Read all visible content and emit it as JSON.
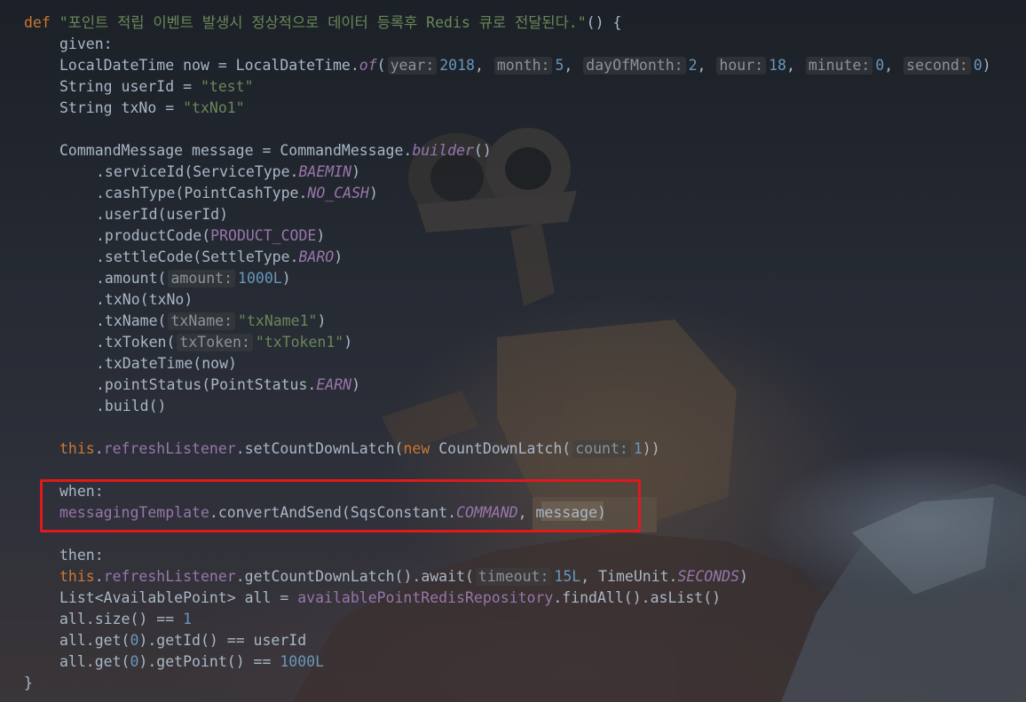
{
  "code": {
    "def_kw": "def",
    "test_name": "\"포인트 적립 이벤트 발생시 정상적으로 데이터 등록후 Redis 큐로 전달된다.\"",
    "def_open": "() {",
    "given_label": "given:",
    "now_decl": "LocalDateTime now = LocalDateTime.",
    "now_of": "of",
    "now_paren": "(",
    "hint_year": "year:",
    "val_year": "2018",
    "hint_month": "month:",
    "val_month": "5",
    "hint_day": "dayOfMonth:",
    "val_day": "2",
    "hint_hour": "hour:",
    "val_hour": "18",
    "hint_minute": "minute:",
    "val_minute": "0",
    "hint_second": "second:",
    "val_second": "0",
    "comma": ",",
    "close_paren": ")",
    "userid_decl": "String userId = ",
    "userid_val": "\"test\"",
    "txno_decl": "String txNo = ",
    "txno_val": "\"txNo1\"",
    "msg_decl": "CommandMessage message = CommandMessage.",
    "msg_builder": "builder",
    "msg_parens": "()",
    "service_pre": ".serviceId(ServiceType.",
    "service_const": "BAEMIN",
    "cash_pre": ".cashType(PointCashType.",
    "cash_const": "NO_CASH",
    "userid_line": ".userId(userId)",
    "product_pre": ".productCode(",
    "product_const": "PRODUCT_CODE",
    "settle_pre": ".settleCode(SettleType.",
    "settle_const": "BARO",
    "amount_pre": ".amount(",
    "hint_amount": "amount:",
    "val_amount": "1000L",
    "txno_line": ".txNo(txNo)",
    "txname_pre": ".txName(",
    "hint_txname": "txName:",
    "val_txname": "\"txName1\"",
    "txtoken_pre": ".txToken(",
    "hint_txtoken": "txToken:",
    "val_txtoken": "\"txToken1\"",
    "txdatetime_line": ".txDateTime(now)",
    "pointstatus_pre": ".pointStatus(PointStatus.",
    "pointstatus_const": "EARN",
    "build_line": ".build()",
    "this_kw": "this",
    "dot": ".",
    "refresh_field": "refreshListener",
    "set_latch": ".setCountDownLatch(",
    "new_kw": "new",
    "countdown_ctor": " CountDownLatch(",
    "hint_count": "count:",
    "val_count": "1",
    "double_close": "))",
    "when_label": "when:",
    "messaging_field": "messagingTemplate",
    "convert_send": ".convertAndSend(SqsConstant.",
    "command_const": "COMMAND",
    "message_arg": ", message)",
    "then_label": "then:",
    "get_latch": ".getCountDownLatch().await(",
    "hint_timeout": "timeout:",
    "val_timeout": "15L",
    "timeunit_pre": ", TimeUnit.",
    "seconds_const": "SECONDS",
    "list_decl": "List<AvailablePoint> all = ",
    "repo_field": "availablePointRedisRepository",
    "find_all": ".findAll().asList()",
    "size_check": "all.size() == ",
    "size_val": "1",
    "getid_pre": "all.get(",
    "getid_idx": "0",
    "getid_post": ").getId() == userId",
    "getpoint_pre": "all.get(",
    "getpoint_idx": "0",
    "getpoint_post": ").getPoint() == ",
    "getpoint_val": "1000L",
    "close_brace": "}"
  }
}
